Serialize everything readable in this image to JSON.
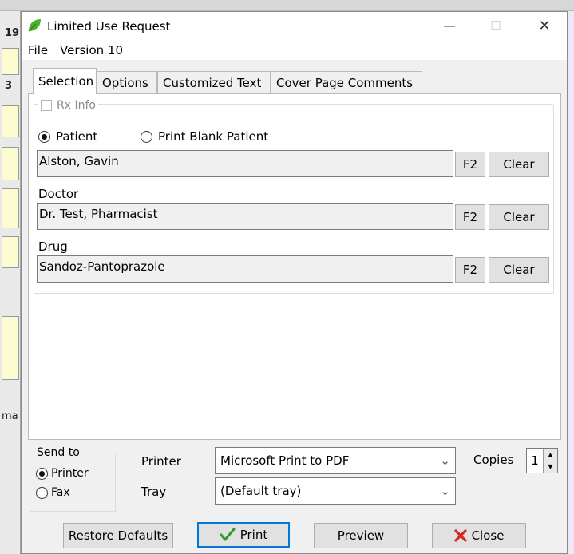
{
  "window": {
    "title": "Limited Use Request",
    "minimize_glyph": "—",
    "maximize_glyph": "☐",
    "close_glyph": "✕",
    "app_icon": "leaf-icon"
  },
  "background": {
    "left_row_number": "19",
    "left_frag_1": "3",
    "left_frag_2": "ma"
  },
  "menu": {
    "file": "File",
    "version": "Version 10"
  },
  "tabs": [
    {
      "label": "Selection",
      "active": true
    },
    {
      "label": "Options"
    },
    {
      "label": "Customized Text"
    },
    {
      "label": "Cover Page Comments"
    }
  ],
  "selection": {
    "rx_info_label": "Rx Info",
    "rx_info_checked": false,
    "patient_radio": "Patient",
    "blank_patient_radio": "Print Blank Patient",
    "patient_value": "Alston, Gavin",
    "doctor_label": "Doctor",
    "doctor_value": "Dr. Test, Pharmacist",
    "drug_label": "Drug",
    "drug_value": "Sandoz-Pantoprazole",
    "f2_label": "F2",
    "clear_label": "Clear"
  },
  "output": {
    "send_to_label": "Send to",
    "printer_radio": "Printer",
    "fax_radio": "Fax",
    "printer_label": "Printer",
    "printer_value": "Microsoft Print to PDF",
    "tray_label": "Tray",
    "tray_value": "(Default tray)",
    "copies_label": "Copies",
    "copies_value": "1"
  },
  "footer": {
    "restore_defaults": "Restore Defaults",
    "print": "Print",
    "preview": "Preview",
    "close": "Close"
  },
  "colors": {
    "accent": "#0078d7",
    "leaf": "#4caf2a",
    "close_x": "#d9261c",
    "check": "#2e9a2e"
  }
}
